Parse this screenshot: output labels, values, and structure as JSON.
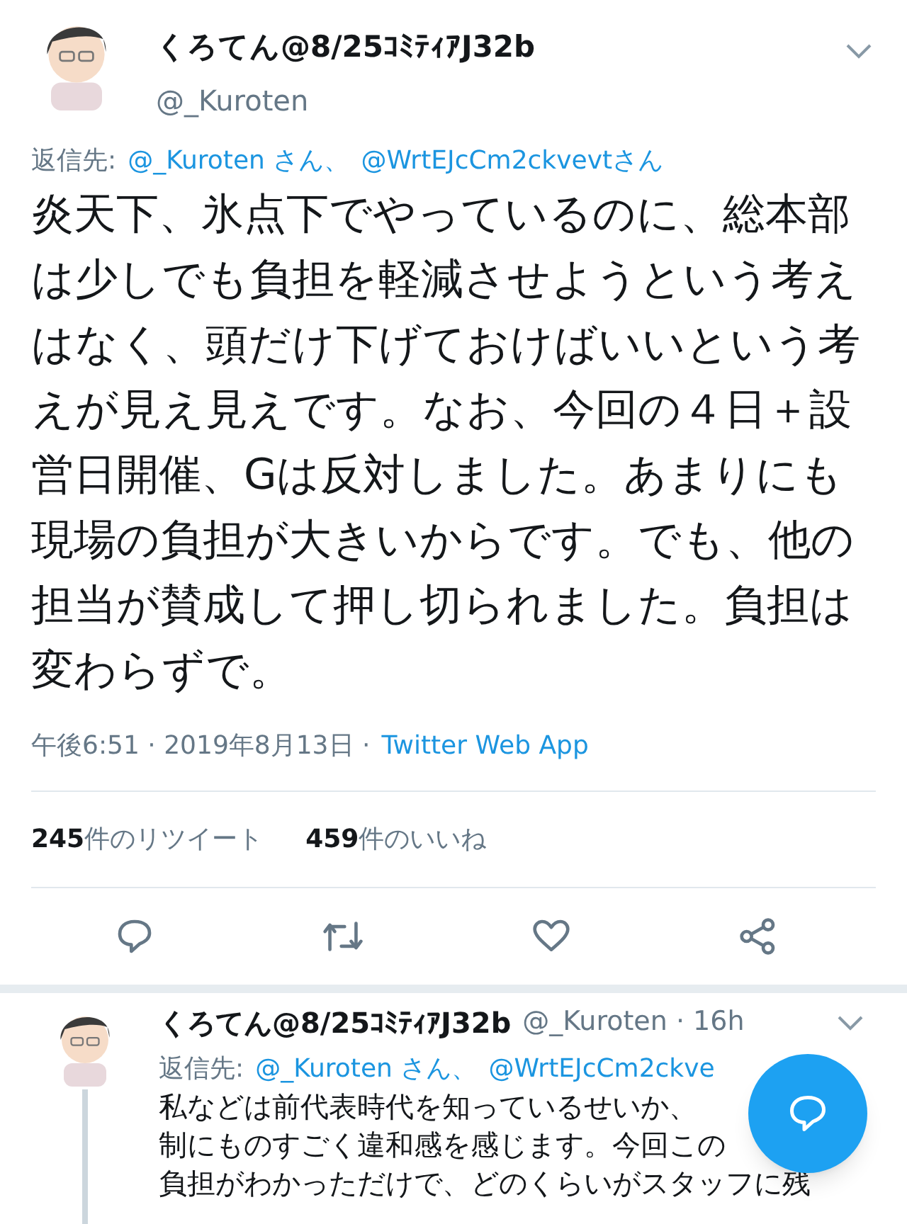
{
  "tweet": {
    "name": "くろてん@8/25ｺﾐﾃｨｱJ32b",
    "handle": "@_Kuroten",
    "reply_to": {
      "label": "返信先:",
      "mentions": [
        "@_Kuroten さん、",
        "@WrtEJcCm2ckvevtさん"
      ]
    },
    "text": "炎天下、氷点下でやっているのに、総本部は少しでも負担を軽減させようという考えはなく、頭だけ下げておけばいいという考えが見え見えです。なお、今回の４日＋設営日開催、Gは反対しました。あまりにも現場の負担が大きいからです。でも、他の担当が賛成して押し切られました。負担は変わらずで。",
    "time": "午後6:51 · 2019年8月13日 ·",
    "source": "Twitter Web App",
    "stats": [
      {
        "count": "245",
        "label": "件のリツイート"
      },
      {
        "count": "459",
        "label": "件のいいね"
      }
    ],
    "actions": [
      {
        "kind": "reply"
      },
      {
        "kind": "retweet"
      },
      {
        "kind": "like"
      },
      {
        "kind": "share"
      }
    ]
  },
  "reply": {
    "name": "くろてん@8/25ｺﾐﾃｨｱJ32b",
    "handle": "@_Kuroten · 16h",
    "reply_to": {
      "label": "返信先:",
      "mentions": [
        "@_Kuroten さん、",
        "@WrtEJcCm2ckve"
      ]
    },
    "lines": [
      "私などは前代表時代を知っているせいか、",
      "制にものすごく違和感を感じます。今回この",
      "負担がわかっただけで、どのくらいがスタッフに残"
    ]
  }
}
